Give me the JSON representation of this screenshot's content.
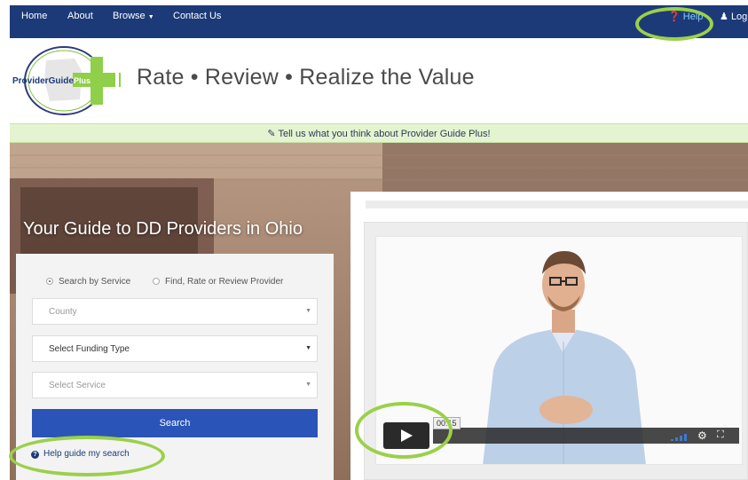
{
  "nav": {
    "home": "Home",
    "about": "About",
    "browse": "Browse",
    "contact": "Contact Us",
    "help": "Help",
    "login": "Login"
  },
  "logo": {
    "text_left": "ProviderGuide",
    "text_right": "Plus"
  },
  "tagline": "Rate • Review • Realize the Value",
  "feedback": "Tell us what you think about Provider Guide Plus!",
  "hero_title": "Your Guide to DD Providers in Ohio",
  "search": {
    "radio_service": "Search by Service",
    "radio_provider": "Find, Rate or Review Provider",
    "county_placeholder": "County",
    "funding": "Select Funding Type",
    "service_placeholder": "Select Service",
    "button": "Search",
    "help_link": "Help guide my search"
  },
  "video": {
    "time": "00:15"
  },
  "colors": {
    "nav_bg": "#1d3a78",
    "highlight": "#9bd04a",
    "button": "#2b54b8",
    "feedback_bg": "#e4f4d0"
  }
}
